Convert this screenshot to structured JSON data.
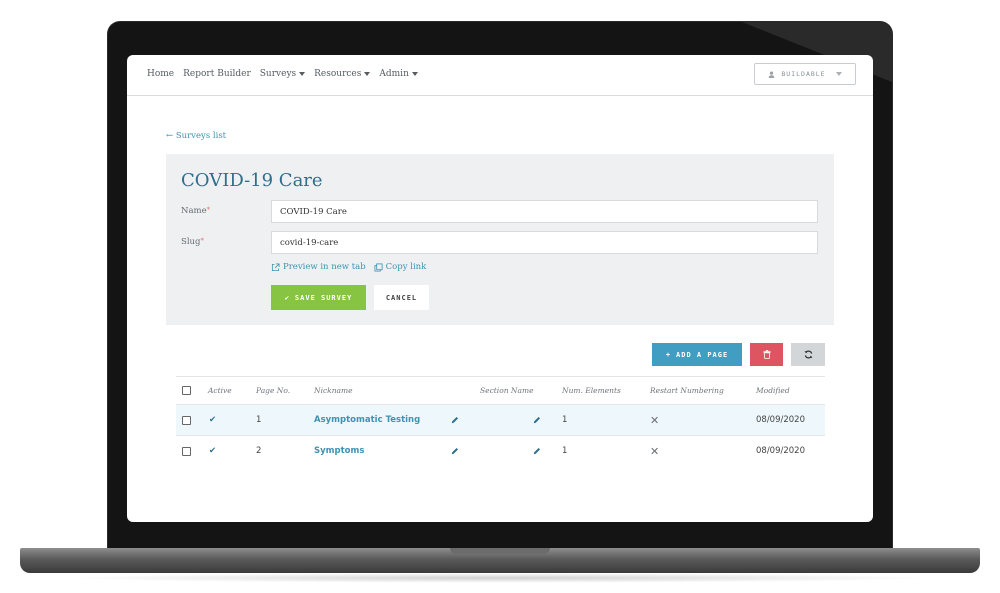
{
  "nav": {
    "items": [
      "Home",
      "Report Builder",
      "Surveys",
      "Resources",
      "Admin"
    ],
    "user_label": "BUILDABLE"
  },
  "back_link": "← Surveys list",
  "form": {
    "title": "COVID-19 Care",
    "name_label": "Name",
    "name_value": "COVID-19 Care",
    "slug_label": "Slug",
    "slug_value": "covid-19-care",
    "required_mark": "*",
    "preview_link": "Preview in new tab",
    "copy_link": "Copy link",
    "save_label": "SAVE SURVEY",
    "cancel_label": "CANCEL"
  },
  "actions": {
    "add_page_label": "ADD A PAGE"
  },
  "table": {
    "columns": [
      "Active",
      "Page No.",
      "Nickname",
      "Section Name",
      "Num. Elements",
      "Restart Numbering",
      "Modified"
    ],
    "rows": [
      {
        "active": "✔",
        "page_no": "1",
        "nickname": "Asymptomatic Testing",
        "num_elements": "1",
        "restart": "✕",
        "modified": "08/09/2020"
      },
      {
        "active": "✔",
        "page_no": "2",
        "nickname": "Symptoms",
        "num_elements": "1",
        "restart": "✕",
        "modified": "08/09/2020"
      }
    ]
  },
  "colors": {
    "accent": "#3d93b1",
    "title": "#2d6f8c",
    "save": "#86c442",
    "add": "#3f9ec2",
    "delete": "#dc5561"
  }
}
